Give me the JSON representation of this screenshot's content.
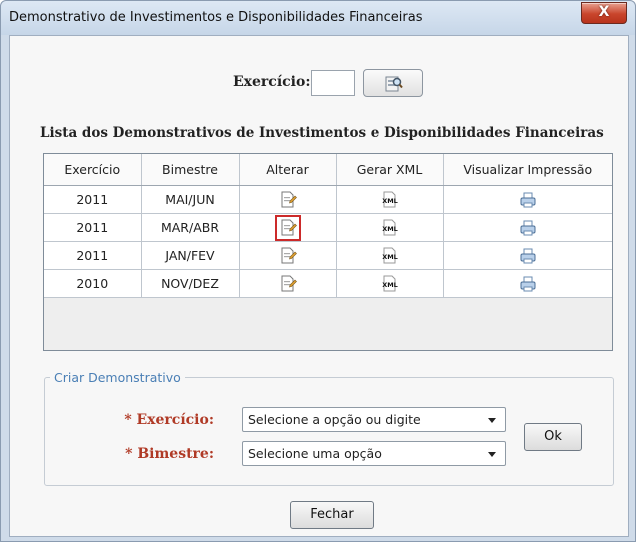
{
  "window": {
    "title": "Demonstrativo de Investimentos e Disponibilidades Financeiras",
    "close_label": "X"
  },
  "filter": {
    "label": "Exercício:",
    "value": ""
  },
  "list": {
    "title": "Lista dos Demonstrativos de Investimentos e Disponibilidades Financeiras",
    "columns": [
      "Exercício",
      "Bimestre",
      "Alterar",
      "Gerar XML",
      "Visualizar Impressão"
    ],
    "rows": [
      {
        "exercicio": "2011",
        "bimestre": "MAI/JUN"
      },
      {
        "exercicio": "2011",
        "bimestre": "MAR/ABR"
      },
      {
        "exercicio": "2011",
        "bimestre": "JAN/FEV"
      },
      {
        "exercicio": "2010",
        "bimestre": "NOV/DEZ"
      }
    ],
    "xml_icon_text": "XML"
  },
  "form": {
    "legend": "Criar Demonstrativo",
    "exercicio_label": "* Exercício:",
    "exercicio_value": "Selecione a opção ou digite",
    "bimestre_label": "* Bimestre:",
    "bimestre_value": "Selecione uma opção",
    "ok_label": "Ok"
  },
  "footer": {
    "close_label": "Fechar"
  },
  "colors": {
    "required_label": "#b03a26",
    "legend": "#4a7fb5",
    "selected_outline": "#cc2a2a"
  }
}
